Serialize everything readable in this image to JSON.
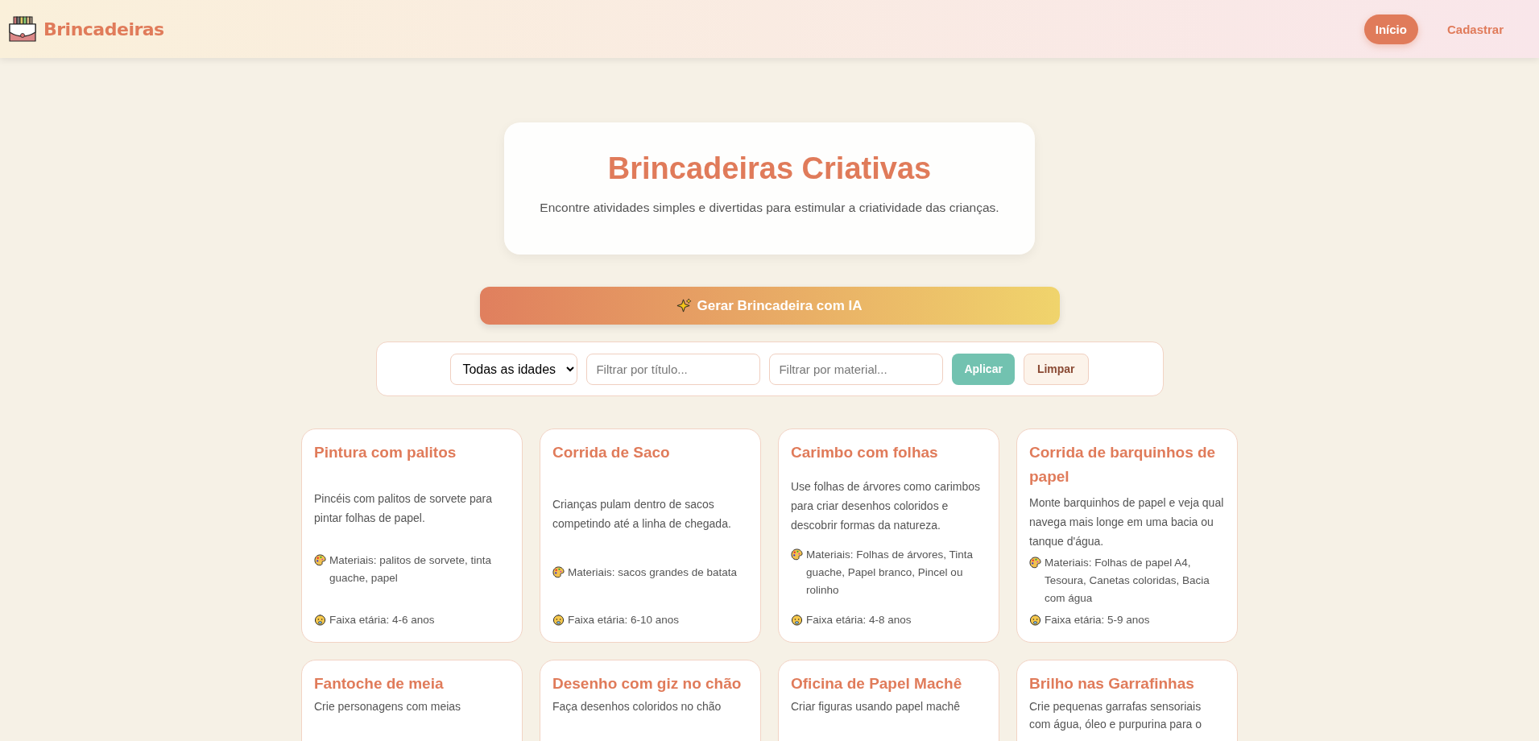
{
  "header": {
    "brand": "Brincadeiras",
    "nav": [
      {
        "label": "Início",
        "selected": true
      },
      {
        "label": "Cadastrar",
        "selected": false
      }
    ]
  },
  "hero": {
    "title": "Brincadeiras Criativas",
    "subtitle": "Encontre atividades simples e divertidas para estimular a criatividade das crianças."
  },
  "ai_button": {
    "label": "Gerar Brincadeira com IA"
  },
  "filters": {
    "age_select": {
      "value": "Todas as idades"
    },
    "title_field": {
      "placeholder": "Filtrar por título..."
    },
    "material_field": {
      "placeholder": "Filtrar por material..."
    },
    "apply_button": "Aplicar",
    "clear_button": "Limpar"
  },
  "cards": [
    {
      "title": "Pintura com palitos",
      "description": "Pincéis com palitos de sorvete para pintar folhas de papel.",
      "materials": "Materiais: palitos de sorvete, tinta guache, papel",
      "age": "Faixa etária: 4-6 anos"
    },
    {
      "title": "Corrida de Saco",
      "description": "Crianças pulam dentro de sacos competindo até a linha de chegada.",
      "materials": "Materiais: sacos grandes de batata",
      "age": "Faixa etária: 6-10 anos"
    },
    {
      "title": "Carimbo com folhas",
      "description": "Use folhas de árvores como carimbos para criar desenhos coloridos e descobrir formas da natureza.",
      "materials": "Materiais: Folhas de árvores, Tinta guache, Papel branco, Pincel ou rolinho",
      "age": "Faixa etária: 4-8 anos"
    },
    {
      "title": "Corrida de barquinhos de papel",
      "description": "Monte barquinhos de papel e veja qual navega mais longe em uma bacia ou tanque d'água.",
      "materials": "Materiais: Folhas de papel A4, Tesoura, Canetas coloridas, Bacia com água",
      "age": "Faixa etária: 5-9 anos"
    },
    {
      "title": "Fantoche de meia",
      "description": "Crie personagens com meias"
    },
    {
      "title": "Desenho com giz no chão",
      "description": "Faça desenhos coloridos no chão"
    },
    {
      "title": "Oficina de Papel Machê",
      "description": "Criar figuras usando papel machê"
    },
    {
      "title": "Brilho nas Garrafinhas",
      "description": "Crie pequenas garrafas sensoriais com água, óleo e purpurina para o"
    }
  ]
}
